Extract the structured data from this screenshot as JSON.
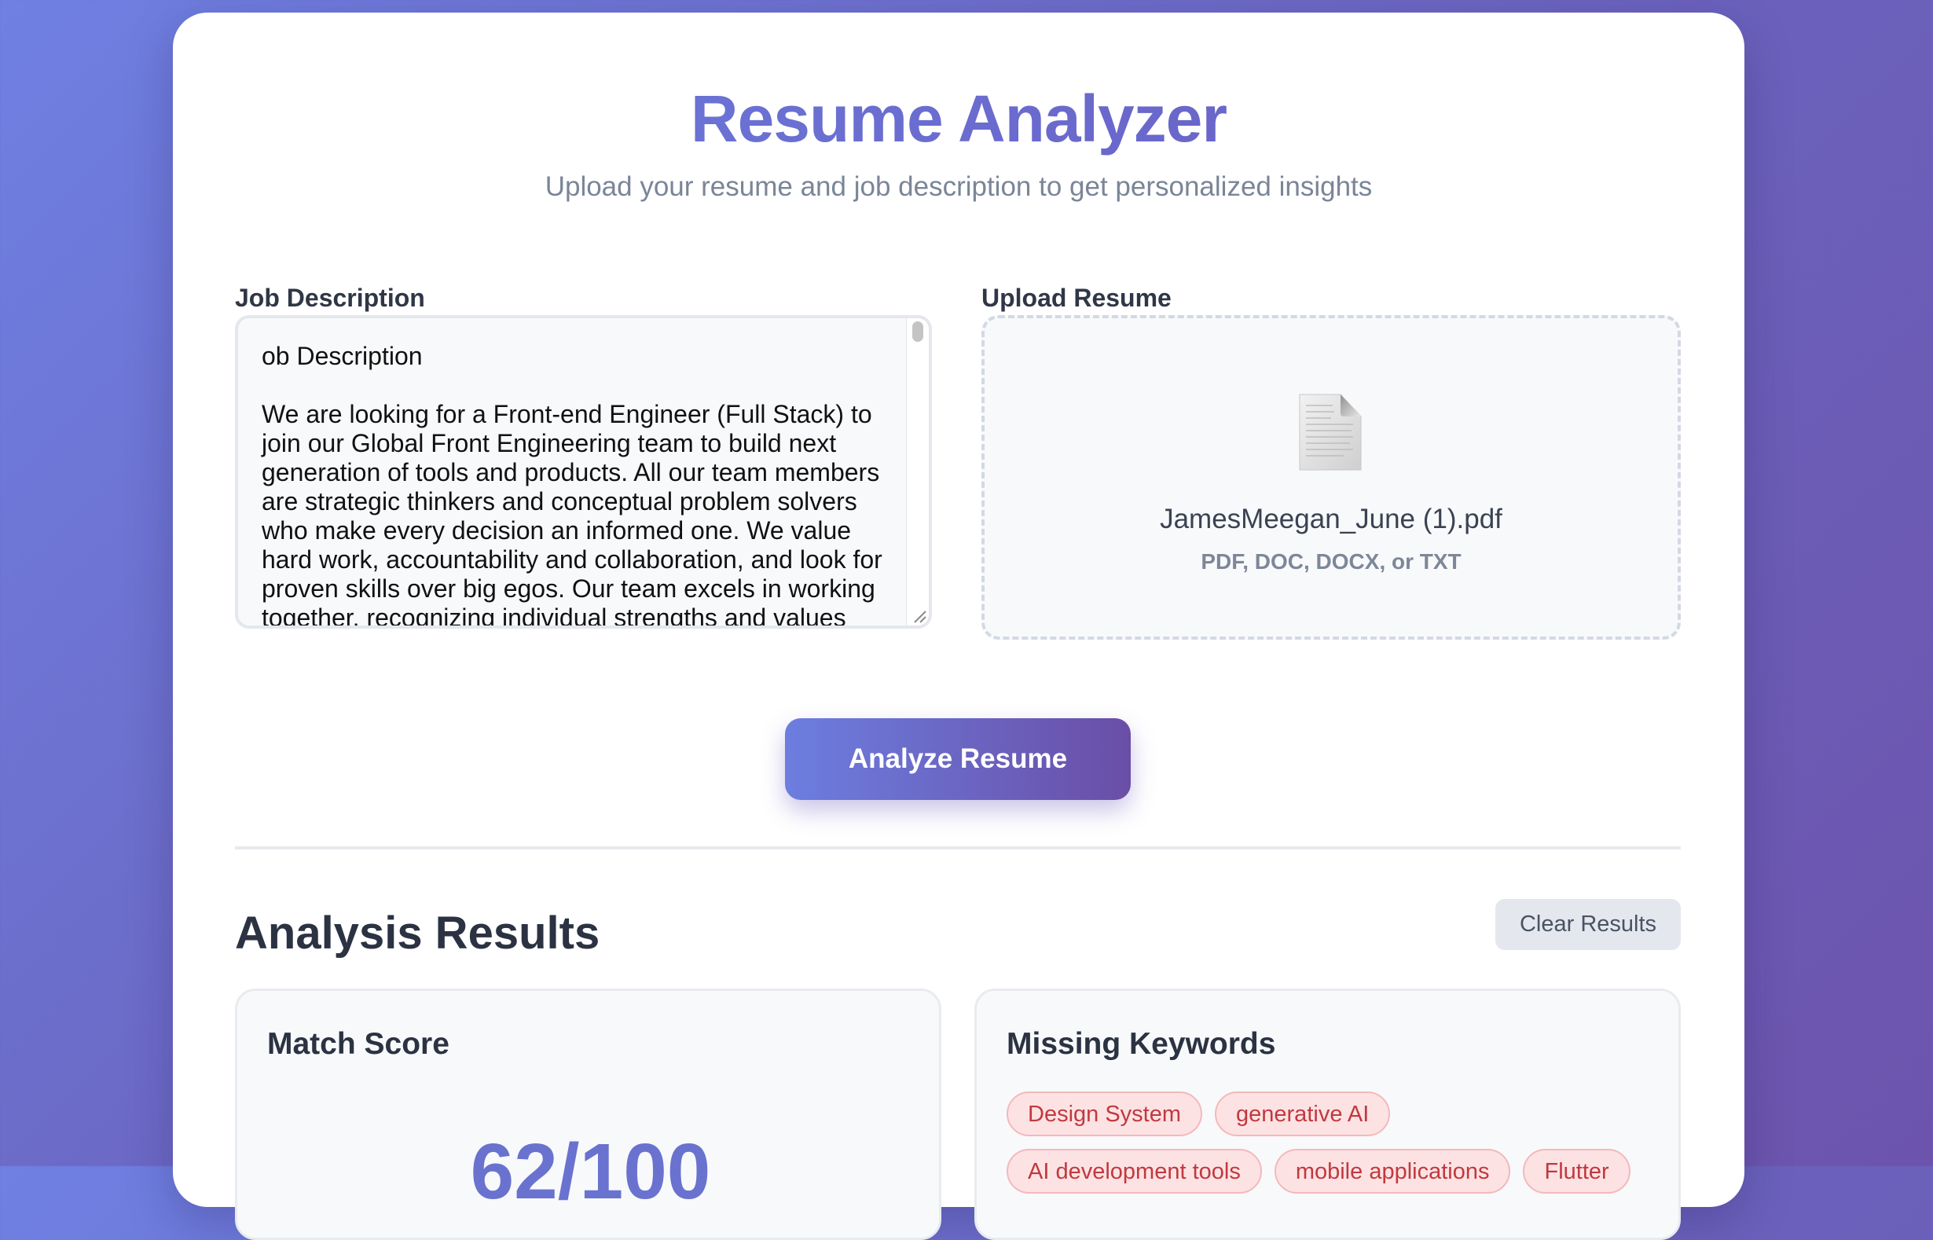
{
  "header": {
    "title": "Resume Analyzer",
    "subtitle": "Upload your resume and job description to get personalized insights"
  },
  "job_description": {
    "label": "Job Description",
    "value": "ob Description\n\nWe are looking for a Front-end Engineer (Full Stack) to join our Global Front Engineering team to build next generation of tools and products. All our team members are strategic thinkers and conceptual problem solvers who make every decision an informed one. We value hard work, accountability and collaboration, and look for proven skills over big egos. Our team excels in working together, recognizing individual strengths and values"
  },
  "upload": {
    "label": "Upload Resume",
    "file_name": "JamesMeegan_June (1).pdf",
    "accepted_types": "PDF, DOC, DOCX, or TXT",
    "icon": "document-icon"
  },
  "actions": {
    "analyze_label": "Analyze Resume",
    "clear_label": "Clear Results"
  },
  "results": {
    "heading": "Analysis Results",
    "match_score": {
      "title": "Match Score",
      "value": "62/100"
    },
    "missing_keywords": {
      "title": "Missing Keywords",
      "keywords": [
        "Design System",
        "generative AI",
        "AI development tools",
        "mobile applications",
        "Flutter"
      ]
    }
  },
  "colors": {
    "accent": "#6a72cf",
    "keyword_bg": "#fde2e3",
    "keyword_text": "#c0393f"
  }
}
